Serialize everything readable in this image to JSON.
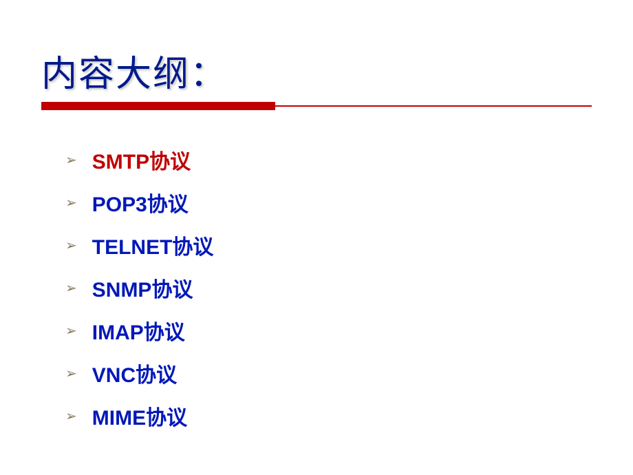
{
  "title": "内容大纲：",
  "items": [
    {
      "text": "SMTP协议",
      "color": "red"
    },
    {
      "text": "POP3协议",
      "color": "blue"
    },
    {
      "text": "TELNET协议",
      "color": "blue"
    },
    {
      "text": "SNMP协议",
      "color": "blue"
    },
    {
      "text": "IMAP协议",
      "color": "blue"
    },
    {
      "text": "VNC协议",
      "color": "blue"
    },
    {
      "text": "MIME协议",
      "color": "blue-deep"
    }
  ]
}
